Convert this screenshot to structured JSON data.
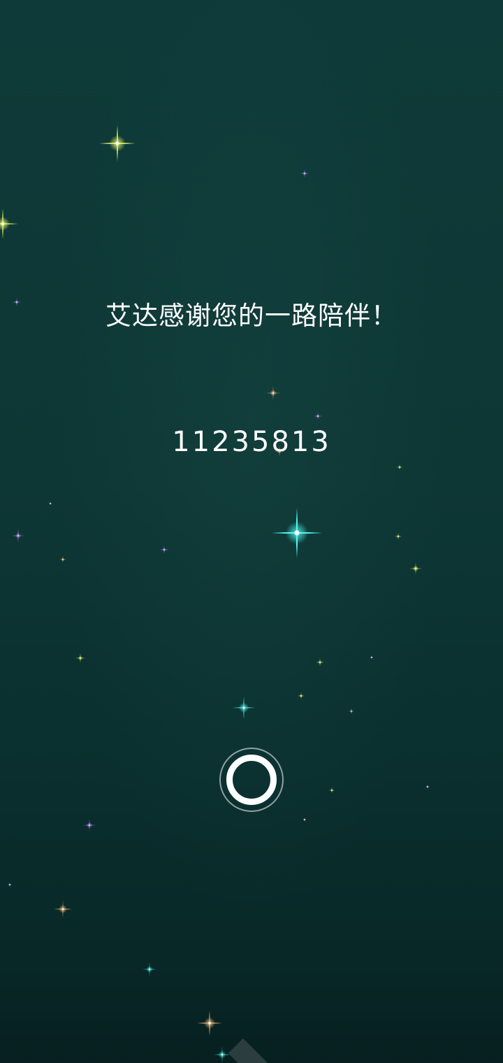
{
  "screen": {
    "message": "艾达感谢您的一路陪伴！",
    "code": "11235813"
  },
  "controls": {
    "continue_button_icon": "ring-icon"
  },
  "colors": {
    "background_top": "#0e3a39",
    "background_bottom": "#071f20",
    "text": "#ffffff",
    "star_yellow": "#f2ff6a",
    "star_cyan": "#4ff7f0",
    "star_purple": "#c58cff",
    "star_orange": "#ffc07a"
  }
}
